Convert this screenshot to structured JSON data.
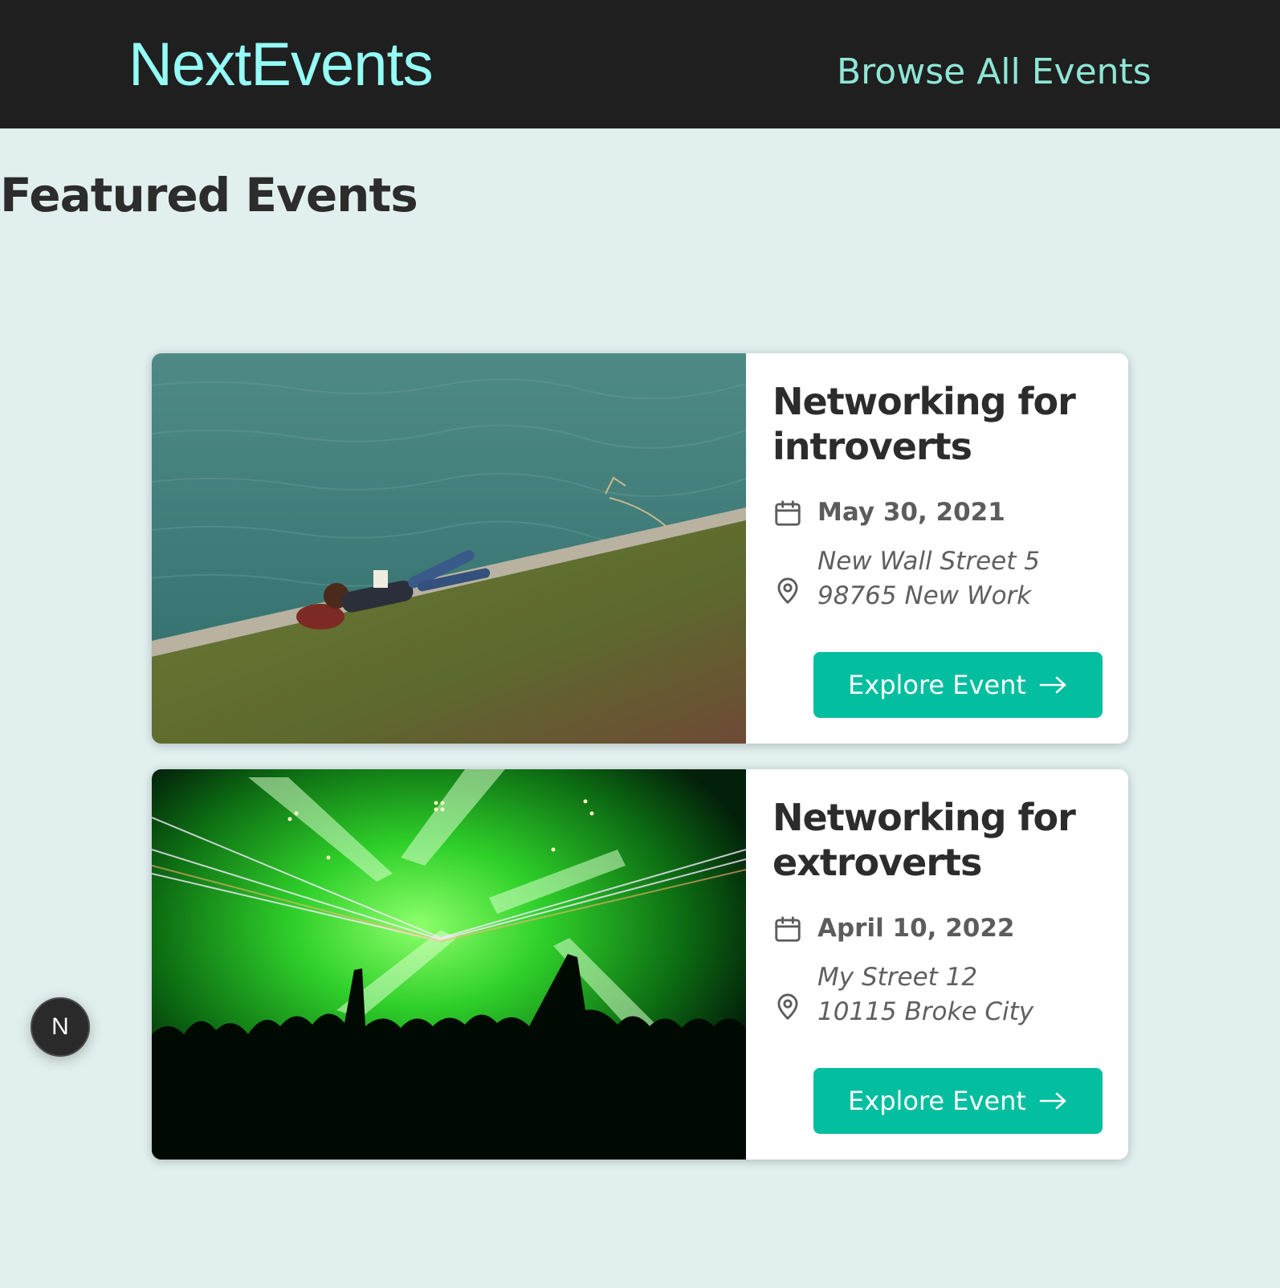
{
  "header": {
    "logo": "NextEvents",
    "nav_link": "Browse All Events"
  },
  "main": {
    "heading": "Featured Events",
    "events": [
      {
        "title": "Networking for introverts",
        "date": "May 30, 2021",
        "address_line1": "New Wall Street 5",
        "address_line2": "98765 New Work",
        "button_label": "Explore Event",
        "image": "person-reading-on-grass-by-water"
      },
      {
        "title": "Networking for extroverts",
        "date": "April 10, 2022",
        "address_line1": "My Street 12",
        "address_line2": "10115 Broke City",
        "button_label": "Explore Event",
        "image": "green-laser-concert-crowd"
      }
    ]
  },
  "badge": {
    "letter": "N"
  },
  "colors": {
    "header_bg": "#1f1f1f",
    "logo": "#94fdf6",
    "nav_link": "#8fe6d6",
    "page_bg": "#e1efef",
    "button": "#03be9f"
  }
}
